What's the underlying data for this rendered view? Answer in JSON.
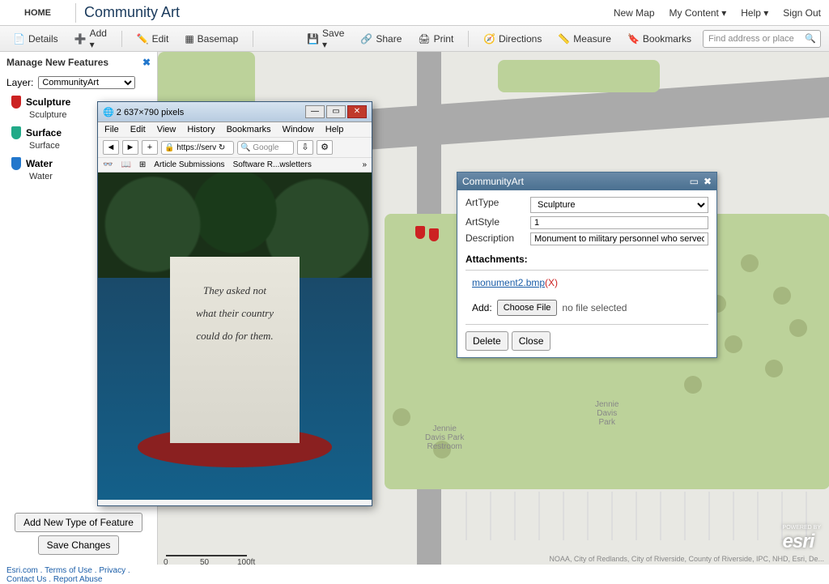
{
  "topbar": {
    "home": "HOME",
    "title": "Community Art",
    "links": {
      "newmap": "New Map",
      "mycontent": "My Content ▾",
      "help": "Help ▾",
      "signout": "Sign Out"
    }
  },
  "toolbar": {
    "details": "Details",
    "add": "Add ▾",
    "edit": "Edit",
    "basemap": "Basemap",
    "save": "Save ▾",
    "share": "Share",
    "print": "Print",
    "directions": "Directions",
    "measure": "Measure",
    "bookmarks": "Bookmarks",
    "search_placeholder": "Find address or place"
  },
  "sidebar": {
    "title": "Manage New Features",
    "layer_label": "Layer:",
    "layer_selected": "CommunityArt",
    "features": [
      {
        "name": "Sculpture",
        "sub": "Sculpture",
        "color": "red"
      },
      {
        "name": "Surface",
        "sub": "Surface",
        "color": "green"
      },
      {
        "name": "Water",
        "sub": "Water",
        "color": "blue"
      }
    ],
    "add_new_btn": "Add New Type of Feature",
    "save_btn": "Save Changes"
  },
  "popup": {
    "title": "CommunityArt",
    "fields": {
      "arttype": {
        "label": "ArtType",
        "value": "Sculpture"
      },
      "artstyle": {
        "label": "ArtStyle",
        "value": "1"
      },
      "description": {
        "label": "Description",
        "value": "Monument to military personnel who served"
      }
    },
    "attachments_label": "Attachments:",
    "attachment": {
      "name": "monument2.bmp",
      "del": "(X)"
    },
    "add_label": "Add:",
    "choose_file": "Choose File",
    "no_file": "no file selected",
    "delete_btn": "Delete",
    "close_btn": "Close"
  },
  "browser": {
    "title": "2 637×790 pixels",
    "menu": [
      "File",
      "Edit",
      "View",
      "History",
      "Bookmarks",
      "Window",
      "Help"
    ],
    "url": "https://serv",
    "search_ph": "Google",
    "bookmarks": [
      "Article Submissions",
      "Software R...wsletters"
    ],
    "monument_lines": [
      "They asked not",
      "what their country",
      "could do for them."
    ]
  },
  "map": {
    "labels": {
      "park": "Jennie\nDavis\nPark",
      "restroom": "Jennie\nDavis Park\nRestroom"
    },
    "scalebar": {
      "min": "0",
      "mid": "50",
      "max": "100ft"
    },
    "attribution": "NOAA, City of Redlands, City of Riverside, County of Riverside, IPC, NHD, Esri, De...",
    "esri_logo": "esri",
    "esri_powered": "POWERED BY"
  },
  "footer": {
    "links": [
      "Esri.com",
      "Terms of Use",
      "Privacy",
      "Contact Us",
      "Report Abuse"
    ]
  }
}
